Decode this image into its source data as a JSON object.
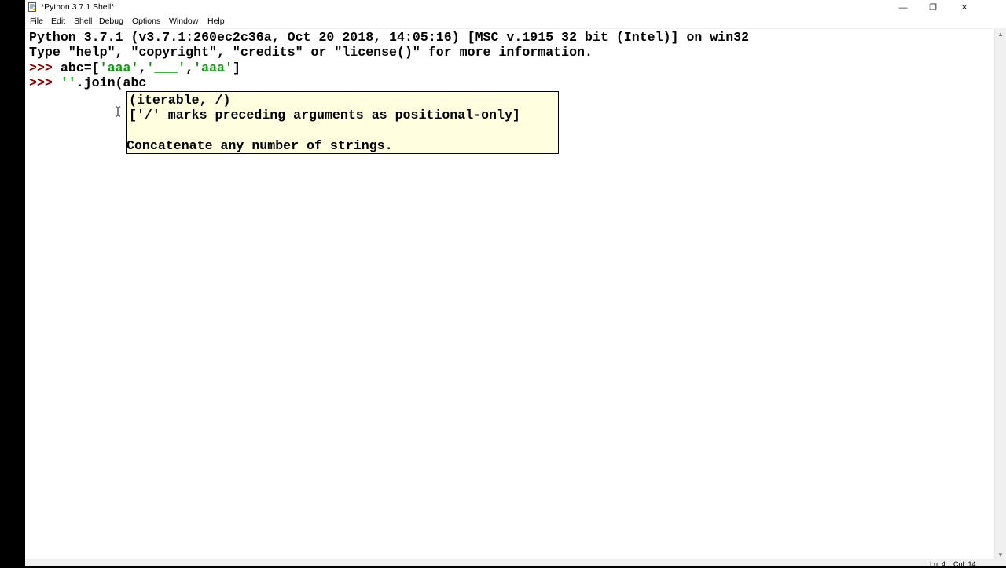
{
  "titlebar": {
    "title": "*Python 3.7.1 Shell*",
    "minimize": "—",
    "maximize": "❐",
    "close": "✕"
  },
  "menu": [
    "File",
    "Edit",
    "Shell",
    "Debug",
    "Options",
    "Window",
    "Help"
  ],
  "shell": {
    "banner1": "Python 3.7.1 (v3.7.1:260ec2c36a, Oct 20 2018, 14:05:16) [MSC v.1915 32 bit (Intel)] on win32",
    "banner2": "Type \"help\", \"copyright\", \"credits\" or \"license()\" for more information.",
    "prompt": ">>>",
    "line1_code_a": "abc=[",
    "line1_str1": "'aaa'",
    "line1_sep1": ",",
    "line1_str2": "'___'",
    "line1_sep2": ",",
    "line1_str3": "'aaa'",
    "line1_code_b": "]",
    "line2_str": "''",
    "line2_code": ".join(abc"
  },
  "calltip": {
    "signature": "(iterable, /)",
    "note": "['/' marks preceding arguments as positional-only]",
    "doc": "Concatenate any number of strings."
  },
  "status": {
    "line": "Ln: 4",
    "col": "Col: 14"
  },
  "colors": {
    "prompt": "#8b0000",
    "string": "#0a9a0a",
    "calltip_bg": "#ffffe0"
  }
}
